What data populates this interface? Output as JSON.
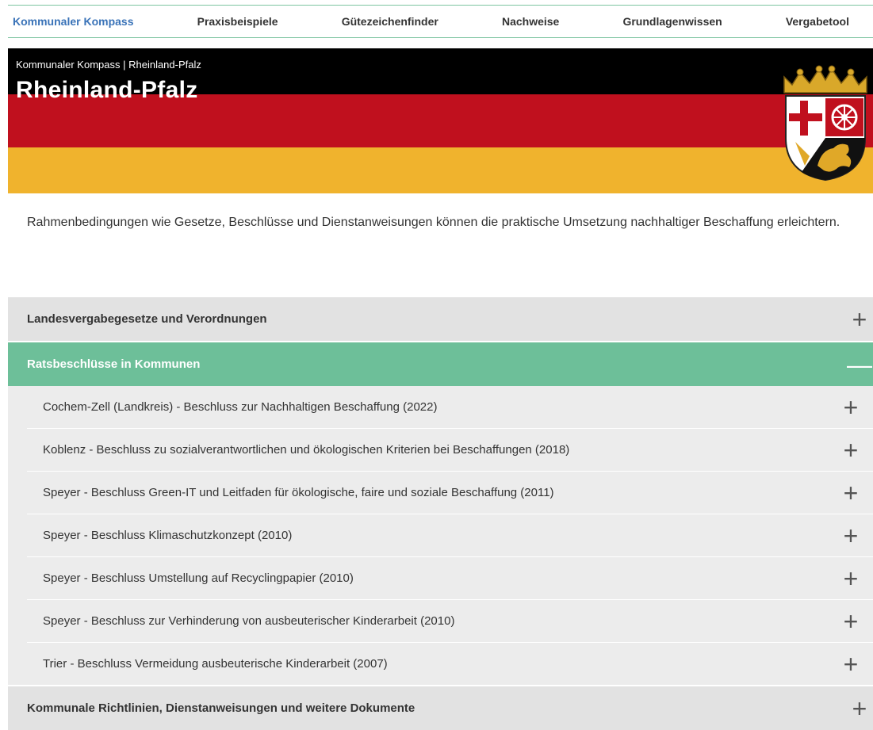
{
  "nav": {
    "items": [
      "Kommunaler Kompass",
      "Praxisbeispiele",
      "Gütezeichenfinder",
      "Nachweise",
      "Grundlagenwissen",
      "Vergabetool"
    ]
  },
  "hero": {
    "breadcrumb": "Kommunaler Kompass | Rheinland-Pfalz",
    "title": "Rheinland-Pfalz"
  },
  "intro": "Rahmenbedingungen wie Gesetze, Beschlüsse und Dienstanweisungen können die praktische Umsetzung nachhaltiger Beschaffung erleichtern.",
  "accordion": {
    "sections": [
      {
        "label": "Landesvergabegesetze und Verordnungen",
        "sign": "+"
      },
      {
        "label": "Ratsbeschlüsse in Kommunen",
        "sign": "—"
      },
      {
        "label": "Kommunale Richtlinien, Dienstanweisungen und weitere Dokumente",
        "sign": "+"
      }
    ],
    "items": [
      "Cochem-Zell (Landkreis) - Beschluss zur Nachhaltigen Beschaffung (2022)",
      "Koblenz - Beschluss zu sozialverantwortlichen und ökologischen Kriterien bei Beschaffungen (2018)",
      "Speyer - Beschluss Green-IT und Leitfaden für ökologische, faire und soziale Beschaffung (2011)",
      "Speyer - Beschluss Klimaschutzkonzept (2010)",
      "Speyer - Beschluss Umstellung auf Recyclingpapier (2010)",
      "Speyer - Beschluss zur Verhinderung von ausbeuterischer Kinderarbeit (2010)",
      "Trier - Beschluss Vermeidung ausbeuterische Kinderarbeit (2007)"
    ],
    "item_sign": "+"
  },
  "colors": {
    "accent_green": "#6dbf99",
    "link_blue": "#3a73b8",
    "flag_black": "#000000",
    "flag_red": "#c0101e",
    "flag_gold": "#f0b32d"
  },
  "icons": {
    "crest": "rheinland-pfalz-coat-of-arms-icon",
    "expand": "plus-icon",
    "collapse": "minus-icon"
  }
}
